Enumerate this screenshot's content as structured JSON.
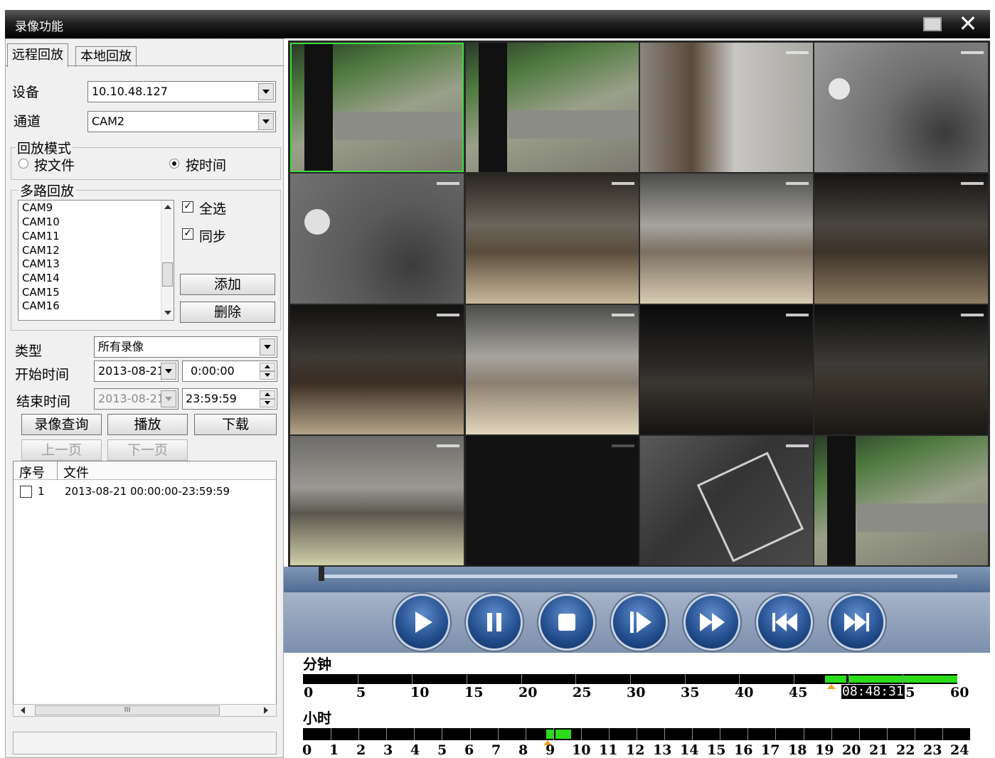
{
  "window": {
    "title": "录像功能"
  },
  "tabs": [
    {
      "label": "远程回放",
      "active": true
    },
    {
      "label": "本地回放",
      "active": false
    }
  ],
  "device": {
    "label": "设备",
    "value": "10.10.48.127"
  },
  "channel": {
    "label": "通道",
    "value": "CAM2"
  },
  "playback_mode": {
    "group_label": "回放模式",
    "by_file": "按文件",
    "by_time": "按时间",
    "selected": "按时间"
  },
  "multi": {
    "group_label": "多路回放",
    "cameras": [
      "CAM9",
      "CAM10",
      "CAM11",
      "CAM12",
      "CAM13",
      "CAM14",
      "CAM15",
      "CAM16"
    ],
    "select_all": "全选",
    "sync": "同步",
    "add": "添加",
    "delete": "删除",
    "select_all_checked": true,
    "sync_checked": true
  },
  "search": {
    "type_label": "类型",
    "type_value": "所有录像",
    "start_label": "开始时间",
    "start_date": "2013-08-21",
    "start_time": "0:00:00",
    "end_label": "结束时间",
    "end_date": "2013-08-21",
    "end_time": "23:59:59"
  },
  "actions": {
    "query": "录像查询",
    "play": "播放",
    "download": "下载",
    "prev_page": "上一页",
    "next_page": "下一页"
  },
  "file_table": {
    "columns": [
      "序号",
      "文件"
    ],
    "rows": [
      {
        "index": "1",
        "file": "2013-08-21 00:00:00-23:59:59"
      }
    ]
  },
  "hscroll_glyph": "III",
  "controls": [
    "play-icon",
    "pause-icon",
    "stop-icon",
    "step-frame-icon",
    "fast-forward-icon",
    "skip-back-icon",
    "skip-next-icon"
  ],
  "timeline": {
    "minute_label": "分钟",
    "hour_label": "小时",
    "minute_ticks": [
      "0",
      "5",
      "10",
      "15",
      "20",
      "25",
      "30",
      "35",
      "40",
      "45",
      "55",
      "60"
    ],
    "hour_ticks": [
      "0",
      "1",
      "2",
      "3",
      "4",
      "5",
      "6",
      "7",
      "8",
      "9",
      "10",
      "11",
      "12",
      "13",
      "14",
      "15",
      "16",
      "17",
      "18",
      "19",
      "20",
      "21",
      "22",
      "23",
      "24"
    ],
    "time_readout": "08:48:31",
    "recorded_color": "#2bdc1a",
    "marker_color": "#f2a51e"
  }
}
